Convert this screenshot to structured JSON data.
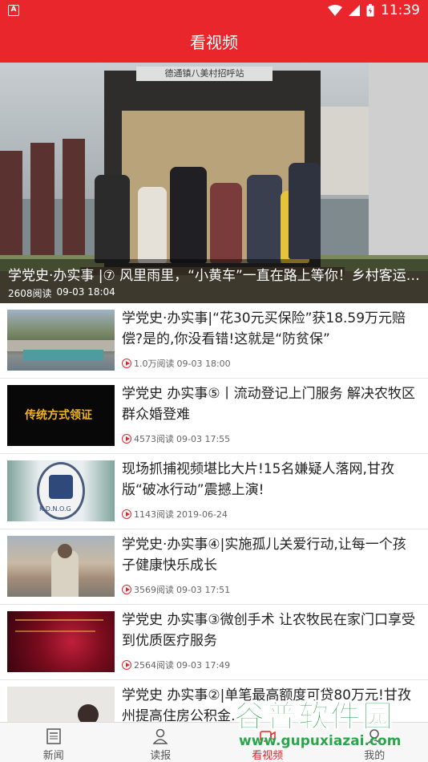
{
  "status_bar": {
    "time": "11:39"
  },
  "app_bar": {
    "title": "看视频"
  },
  "hero": {
    "title": "学党史·办实事 |⑦ 风里雨里，“小黄车”一直在路上等你！乡村客运…",
    "reads": "2608阅读",
    "time": "09-03 18:04",
    "sign_text": "德通镇八美村招呼站"
  },
  "news": [
    {
      "title": "学党史·办实事|“花30元买保险”获18.59万元赔偿?是的,你没看错!这就是“防贫保”",
      "reads": "1.0万阅读",
      "time": "09-03 18:00"
    },
    {
      "title": "学党史 办实事⑤丨流动登记上门服务 解决农牧区群众婚登难",
      "reads": "4573阅读",
      "time": "09-03 17:55",
      "thumb_text": "传统方式领证"
    },
    {
      "title": "现场抓捕视频堪比大片!15名嫌疑人落网,甘孜版“破冰行动”震撼上演!",
      "reads": "1143阅读",
      "time": "2019-06-24",
      "thumb_text": "K.D.N.O.G"
    },
    {
      "title": "学党史·办实事④|实施孤儿关爱行动,让每一个孩子健康快乐成长",
      "reads": "3569阅读",
      "time": "09-03 17:51"
    },
    {
      "title": "学党史 办实事③微创手术 让农牧民在家门口享受到优质医疗服务",
      "reads": "2564阅读",
      "time": "09-03 17:49"
    },
    {
      "title": "学党史 办实事②|单笔最高额度可贷80万元!甘孜州提高住房公积金…",
      "reads": "",
      "time": ""
    }
  ],
  "bottom_nav": [
    {
      "label": "新闻",
      "icon": "newspaper-icon"
    },
    {
      "label": "读报",
      "icon": "reader-icon"
    },
    {
      "label": "看视频",
      "icon": "video-icon"
    },
    {
      "label": "我的",
      "icon": "user-icon"
    }
  ],
  "watermark": {
    "title": "谷普软件园",
    "url": "www.gupuxiazai.com"
  },
  "colors": {
    "brand": "#e8262b",
    "watermark": "#2aa54a"
  }
}
